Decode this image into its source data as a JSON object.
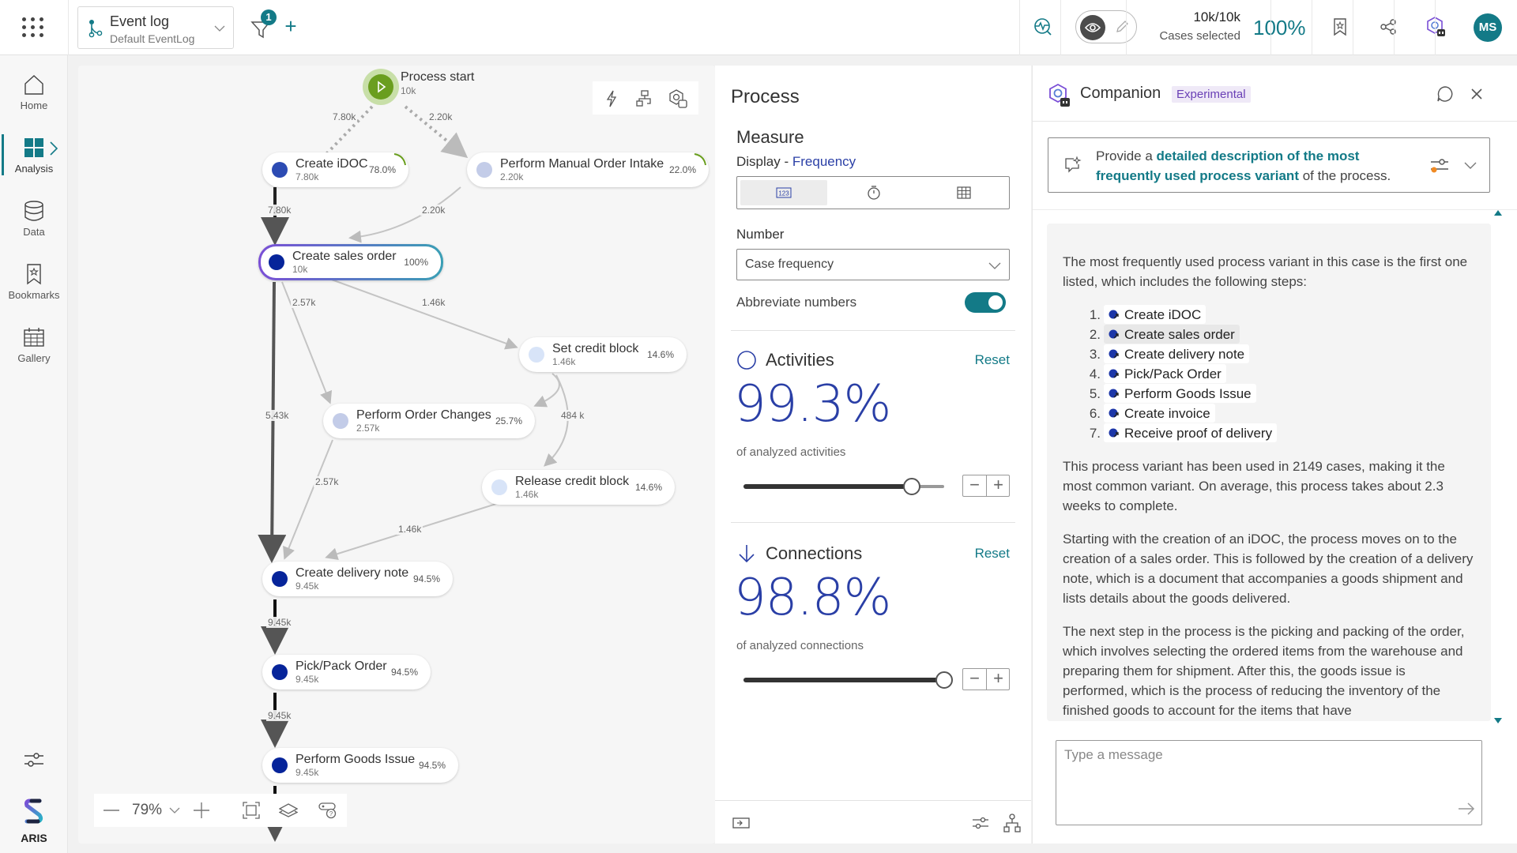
{
  "topbar": {
    "event_log": {
      "title": "Event log",
      "subtitle": "Default EventLog"
    },
    "filter_count": "1",
    "add_filter_label": "+",
    "cases_count": "10k/10k",
    "cases_label": "Cases selected",
    "cases_percent": "100%",
    "user_initials": "MS",
    "icons": [
      "apps-grid-icon",
      "event-log-icon",
      "filter-icon",
      "add-icon",
      "analysis-search-icon",
      "view-mode-icon",
      "edit-mode-icon",
      "bookmark-icon",
      "share-icon",
      "companion-icon"
    ]
  },
  "nav": {
    "items": [
      {
        "label": "Home",
        "icon": "home-icon",
        "active": false
      },
      {
        "label": "Analysis",
        "icon": "analysis-icon",
        "active": true
      },
      {
        "label": "Data",
        "icon": "database-icon",
        "active": false
      },
      {
        "label": "Bookmarks",
        "icon": "bookmark-icon",
        "active": false
      },
      {
        "label": "Gallery",
        "icon": "gallery-icon",
        "active": false
      }
    ],
    "brand": "ARIS"
  },
  "canvas": {
    "start": {
      "label": "Process start",
      "count": "10k"
    },
    "nodes": [
      {
        "name": "Create iDOC",
        "count": "7.80k",
        "pct": "78.0%",
        "shade": "mid"
      },
      {
        "name": "Perform Manual Order Intake",
        "count": "2.20k",
        "pct": "22.0%",
        "shade": "light"
      },
      {
        "name": "Create sales order",
        "count": "10k",
        "pct": "100%",
        "shade": "dark",
        "selected": true
      },
      {
        "name": "Set credit block",
        "count": "1.46k",
        "pct": "14.6%",
        "shade": "pale"
      },
      {
        "name": "Perform Order Changes",
        "count": "2.57k",
        "pct": "25.7%",
        "shade": "light"
      },
      {
        "name": "Release credit block",
        "count": "1.46k",
        "pct": "14.6%",
        "shade": "pale"
      },
      {
        "name": "Create delivery note",
        "count": "9.45k",
        "pct": "94.5%",
        "shade": "dark"
      },
      {
        "name": "Pick/Pack Order",
        "count": "9.45k",
        "pct": "94.5%",
        "shade": "dark"
      },
      {
        "name": "Perform Goods Issue",
        "count": "9.45k",
        "pct": "94.5%",
        "shade": "dark"
      }
    ],
    "edges": [
      {
        "from": "Process start",
        "to": "Create iDOC",
        "label": "7.80k"
      },
      {
        "from": "Process start",
        "to": "Perform Manual Order Intake",
        "label": "2.20k"
      },
      {
        "from": "Create iDOC",
        "to": "Create sales order",
        "label": "7.80k"
      },
      {
        "from": "Perform Manual Order Intake",
        "to": "Create sales order",
        "label": "2.20k"
      },
      {
        "from": "Create sales order",
        "to": "Perform Order Changes",
        "label": "2.57k"
      },
      {
        "from": "Create sales order",
        "to": "Set credit block",
        "label": "1.46k"
      },
      {
        "from": "Create sales order",
        "to": "Create delivery note",
        "label": "5.43k"
      },
      {
        "from": "Set credit block",
        "to": "Perform Order Changes",
        "label": "484 k"
      },
      {
        "from": "Set credit block",
        "to": "Release credit block",
        "label": ""
      },
      {
        "from": "Perform Order Changes",
        "to": "Create delivery note",
        "label": "2.57k"
      },
      {
        "from": "Release credit block",
        "to": "Create delivery note",
        "label": "1.46k"
      },
      {
        "from": "Create delivery note",
        "to": "Pick/Pack Order",
        "label": "9.45k"
      },
      {
        "from": "Pick/Pack Order",
        "to": "Perform Goods Issue",
        "label": "9.45k"
      },
      {
        "from": "Perform Goods Issue",
        "to": "next",
        "label": "9.45k"
      }
    ],
    "zoom_level": "79%",
    "tool_icons": [
      "lightning-icon",
      "hierarchy-icon",
      "companion-hex-icon"
    ]
  },
  "process": {
    "title": "Process",
    "measure": "Measure",
    "display_prefix": "Display - ",
    "display_value": "Frequency",
    "number_label": "Number",
    "number_value": "Case frequency",
    "abbreviate_label": "Abbreviate numbers",
    "abbreviate_on": true,
    "activities": {
      "title": "Activities",
      "reset": "Reset",
      "percent": "99.3%",
      "sublabel": "of analyzed activities",
      "slider_fraction": 0.84
    },
    "connections": {
      "title": "Connections",
      "reset": "Reset",
      "percent": "98.8%",
      "sublabel": "of analyzed connections",
      "slider_fraction": 1.0
    },
    "stepper": {
      "minus": "−",
      "plus": "+"
    }
  },
  "companion": {
    "title": "Companion",
    "badge": "Experimental",
    "prompt": {
      "pre": "Provide a ",
      "highlight": "detailed description of the most frequently used process variant",
      "post": " of the process."
    },
    "answer": {
      "intro": "The most frequently used process variant in this case is the first one listed, which includes the following steps:",
      "steps": [
        "Create iDOC",
        "Create sales order",
        "Create delivery note",
        "Pick/Pack Order",
        "Perform Goods Issue",
        "Create invoice",
        "Receive proof of delivery"
      ],
      "p2": "This process variant has been used in 2149 cases, making it the most common variant. On average, this process takes about 2.3 weeks to complete.",
      "p3": "Starting with the creation of an iDOC, the process moves on to the creation of a sales order. This is followed by the creation of a delivery note, which is a document that accompanies a goods shipment and lists details about the goods delivered.",
      "p4": "The next step in the process is the picking and packing of the order, which involves selecting the ordered items from the warehouse and preparing them for shipment. After this, the goods issue is performed, which is the process of reducing the inventory of the finished goods to account for the items that have"
    },
    "input_placeholder": "Type a message"
  }
}
